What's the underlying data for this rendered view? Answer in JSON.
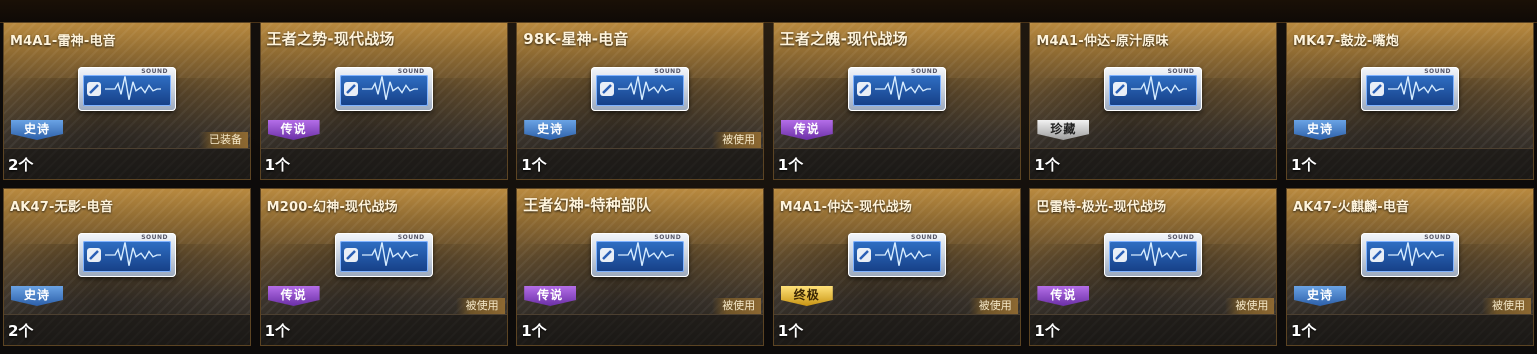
{
  "items": [
    {
      "title": "M4A1-雷神-电音",
      "rarity": "史诗",
      "rarity_type": "epic",
      "status": "已装备",
      "count": "2个"
    },
    {
      "title": "王者之势-现代战场",
      "rarity": "传说",
      "rarity_type": "legend",
      "status": "",
      "count": "1个"
    },
    {
      "title": "98K-星神-电音",
      "rarity": "史诗",
      "rarity_type": "epic",
      "status": "被使用",
      "count": "1个"
    },
    {
      "title": "王者之魄-现代战场",
      "rarity": "传说",
      "rarity_type": "legend",
      "status": "",
      "count": "1个"
    },
    {
      "title": "M4A1-仲达-原汁原味",
      "rarity": "珍藏",
      "rarity_type": "rare",
      "status": "",
      "count": "1个"
    },
    {
      "title": "MK47-鼓龙-嘴炮",
      "rarity": "史诗",
      "rarity_type": "epic",
      "status": "",
      "count": "1个"
    },
    {
      "title": "AK47-无影-电音",
      "rarity": "史诗",
      "rarity_type": "epic",
      "status": "",
      "count": "2个"
    },
    {
      "title": "M200-幻神-现代战场",
      "rarity": "传说",
      "rarity_type": "legend",
      "status": "被使用",
      "count": "1个"
    },
    {
      "title": "王者幻神-特种部队",
      "rarity": "传说",
      "rarity_type": "legend",
      "status": "被使用",
      "count": "1个"
    },
    {
      "title": "M4A1-仲达-现代战场",
      "rarity": "终极",
      "rarity_type": "ultimate",
      "status": "被使用",
      "count": "1个"
    },
    {
      "title": "巴雷特-极光-现代战场",
      "rarity": "传说",
      "rarity_type": "legend",
      "status": "被使用",
      "count": "1个"
    },
    {
      "title": "AK47-火麒麟-电音",
      "rarity": "史诗",
      "rarity_type": "epic",
      "status": "被使用",
      "count": "1个"
    }
  ],
  "card_art": {
    "label": "SOUND",
    "icon": "sound-wave-card-icon"
  },
  "colors": {
    "epic": "#2c5fa8",
    "legend": "#6b2fa6",
    "rare": "#9d9d9d",
    "ultimate": "#c99513",
    "card_gold": "#b98a3f"
  }
}
